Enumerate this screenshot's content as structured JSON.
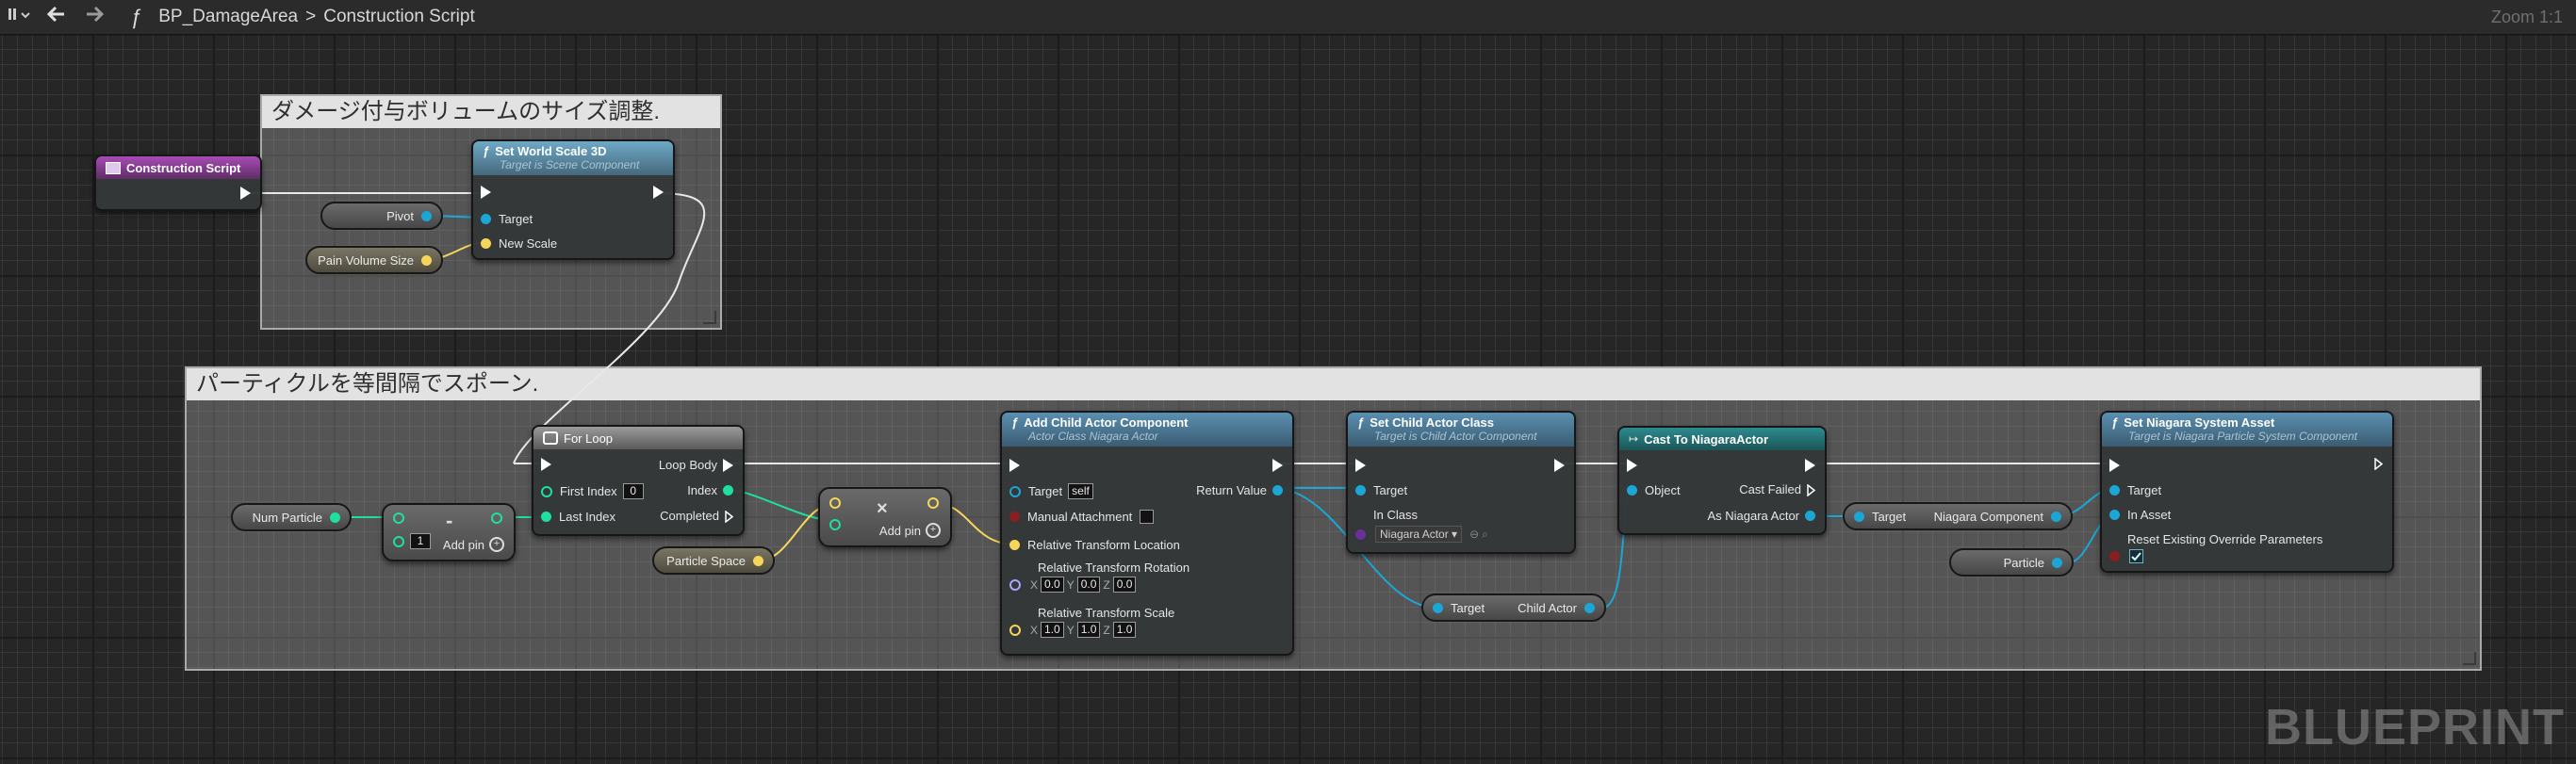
{
  "toolbar": {
    "function_glyph": "ƒ",
    "blueprint_name": "BP_DamageArea",
    "separator": ">",
    "graph_name": "Construction Script",
    "zoom": "Zoom 1:1"
  },
  "comments": [
    {
      "title": "ダメージ付与ボリュームのサイズ調整."
    },
    {
      "title": "パーティクルを等間隔でスポーン."
    }
  ],
  "nodes": {
    "construction_script": {
      "title": "Construction Script"
    },
    "set_world_scale": {
      "title": "Set World Scale 3D",
      "subtitle": "Target is Scene Component",
      "pins": [
        "Target",
        "New Scale"
      ]
    },
    "pivot": {
      "label": "Pivot"
    },
    "pain_volume_size": {
      "label": "Pain Volume Size"
    },
    "num_particle": {
      "label": "Num Particle"
    },
    "subtract": {
      "symbol": "-",
      "value": "1",
      "add_pin": "Add pin"
    },
    "for_loop": {
      "title": "For Loop",
      "first_index": "First Index",
      "first_index_value": "0",
      "last_index": "Last Index",
      "loop_body": "Loop Body",
      "index": "Index",
      "completed": "Completed"
    },
    "particle_space": {
      "label": "Particle Space"
    },
    "multiply": {
      "symbol": "×",
      "add_pin": "Add pin"
    },
    "add_child_actor": {
      "title": "Add Child Actor Component",
      "subtitle": "Actor Class Niagara Actor",
      "target": "Target",
      "target_value": "self",
      "manual_attachment": "Manual Attachment",
      "return_value": "Return Value",
      "rel_location": "Relative Transform Location",
      "rel_rotation": "Relative Transform Rotation",
      "rel_scale": "Relative Transform Scale",
      "rotation": {
        "x": "0.0",
        "y": "0.0",
        "z": "0.0"
      },
      "scale": {
        "x": "1.0",
        "y": "1.0",
        "z": "1.0"
      }
    },
    "set_child_actor_class": {
      "title": "Set Child Actor Class",
      "subtitle": "Target is Child Actor Component",
      "target": "Target",
      "in_class": "In Class",
      "class_value": "Niagara Actor"
    },
    "get_child_actor": {
      "target": "Target",
      "child_actor": "Child Actor"
    },
    "cast_to_niagara": {
      "title": "Cast To NiagaraActor",
      "object": "Object",
      "cast_failed": "Cast Failed",
      "as_niagara_actor": "As Niagara Actor"
    },
    "get_niagara_component": {
      "target": "Target",
      "component": "Niagara Component"
    },
    "particle": {
      "label": "Particle"
    },
    "set_niagara_asset": {
      "title": "Set Niagara System Asset",
      "subtitle": "Target is Niagara Particle System Component",
      "target": "Target",
      "in_asset": "In Asset",
      "reset": "Reset Existing Override Parameters"
    }
  },
  "xyz_labels": {
    "x": "X",
    "y": "Y",
    "z": "Z"
  },
  "watermark": "BLUEPRINT",
  "colors": {
    "exec": "#ffffff",
    "object": "#1ba6d6",
    "integer": "#1fdfa0",
    "vector": "#f5d65a",
    "rotator": "#a7a7ff",
    "boolean": "#8b1e1e",
    "class": "#6b2f9a"
  }
}
